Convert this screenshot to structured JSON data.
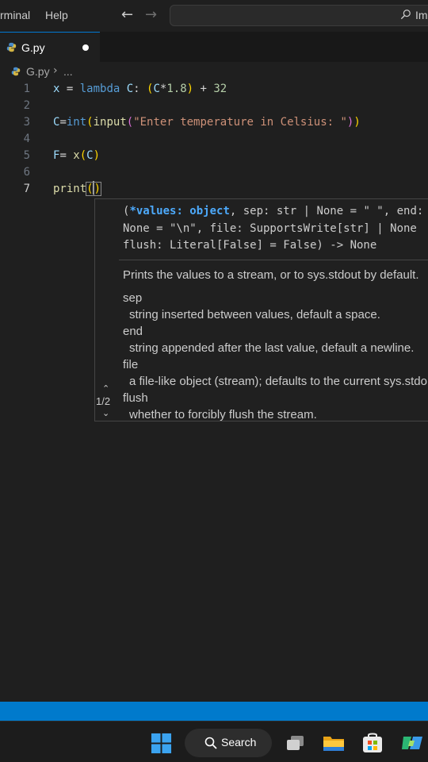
{
  "menu": {
    "terminal": "rminal",
    "help": "Help"
  },
  "search": {
    "text": "Im"
  },
  "tab": {
    "label": "G.py"
  },
  "breadcrumb": {
    "file": "G.py",
    "ellipsis": "..."
  },
  "editor": {
    "line_numbers": [
      "1",
      "2",
      "3",
      "4",
      "5",
      "6",
      "7"
    ],
    "lines": [
      "x = lambda C: (C*1.8) + 32",
      "",
      "C=int(input(\"Enter temperature in Celsius: \"))",
      "",
      "F= x(C)",
      "",
      "print()"
    ]
  },
  "param_hint": {
    "counter": "1/2",
    "signature": {
      "open": "(",
      "active_param": "*values: object",
      "rest_line1": ", sep: str | None = \" \", end:",
      "line2": "None = \"\\n\", file: SupportsWrite[str] | None",
      "line3": "flush: Literal[False] = False) -> None"
    },
    "summary": "Prints the values to a stream, or to sys.stdout by default.",
    "params": [
      {
        "name": "sep",
        "desc": "string inserted between values, default a space."
      },
      {
        "name": "end",
        "desc": "string appended after the last value, default a newline."
      },
      {
        "name": "file",
        "desc": "a file-like object (stream); defaults to the current sys.stdo"
      },
      {
        "name": "flush",
        "desc": "whether to forcibly flush the stream."
      }
    ]
  },
  "taskbar": {
    "search_label": "Search"
  },
  "colors": {
    "editor_bg": "#1f1f1f",
    "statusbar": "#007acc",
    "active_param": "#4daafc",
    "string": "#ce9178",
    "keyword": "#569cd6",
    "function": "#dcdcaa",
    "variable": "#9cdcfe"
  }
}
